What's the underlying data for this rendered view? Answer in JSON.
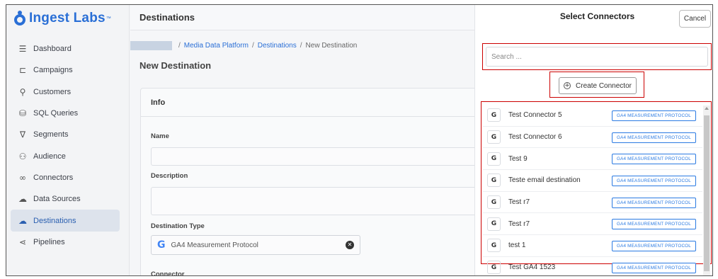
{
  "app": {
    "name": "Ingest Labs",
    "tm": "™"
  },
  "sidebar": {
    "items": [
      {
        "label": "Dashboard",
        "icon": "list-icon",
        "glyph": "☰"
      },
      {
        "label": "Campaigns",
        "icon": "megaphone-icon",
        "glyph": "⊏"
      },
      {
        "label": "Customers",
        "icon": "user-icon",
        "glyph": "⚲"
      },
      {
        "label": "SQL Queries",
        "icon": "database-icon",
        "glyph": "⛁"
      },
      {
        "label": "Segments",
        "icon": "filter-icon",
        "glyph": "∇"
      },
      {
        "label": "Audience",
        "icon": "users-icon",
        "glyph": "⚇"
      },
      {
        "label": "Connectors",
        "icon": "link-icon",
        "glyph": "∞"
      },
      {
        "label": "Data Sources",
        "icon": "cloud-upload-icon",
        "glyph": "☁"
      },
      {
        "label": "Destinations",
        "icon": "cloud-arrow-icon",
        "glyph": "☁",
        "active": true
      },
      {
        "label": "Pipelines",
        "icon": "share-nodes-icon",
        "glyph": "⋖"
      }
    ]
  },
  "main": {
    "header": "Destinations",
    "breadcrumb": {
      "sep": "/",
      "items": [
        "Media Data Platform",
        "Destinations",
        "New Destination"
      ]
    },
    "page_title": "New Destination",
    "card_title": "Info",
    "fields": {
      "name_label": "Name",
      "description_label": "Description",
      "destination_type_label": "Destination Type",
      "destination_type_value": "GA4 Measurement Protocol",
      "connector_label": "Connector"
    }
  },
  "panel": {
    "title": "Select Connectors",
    "cancel_label": "Cancel",
    "search_placeholder": "Search ...",
    "create_label": "Create Connector",
    "connectors": [
      {
        "name": "Test Connector 5",
        "type": "GA4 MEASUREMENT PROTOCOL"
      },
      {
        "name": "Test Connector 6",
        "type": "GA4 MEASUREMENT PROTOCOL"
      },
      {
        "name": "Test 9",
        "type": "GA4 MEASUREMENT PROTOCOL"
      },
      {
        "name": "Teste email destination",
        "type": "GA4 MEASUREMENT PROTOCOL"
      },
      {
        "name": "Test r7",
        "type": "GA4 MEASUREMENT PROTOCOL"
      },
      {
        "name": "Test r7",
        "type": "GA4 MEASUREMENT PROTOCOL"
      },
      {
        "name": "test 1",
        "type": "GA4 MEASUREMENT PROTOCOL"
      },
      {
        "name": "Test GA4 1523",
        "type": "GA4 MEASUREMENT PROTOCOL"
      }
    ]
  },
  "colors": {
    "accent": "#2a6fd6",
    "highlight": "#cc0000",
    "tag_blue": "#2a7ae2"
  }
}
